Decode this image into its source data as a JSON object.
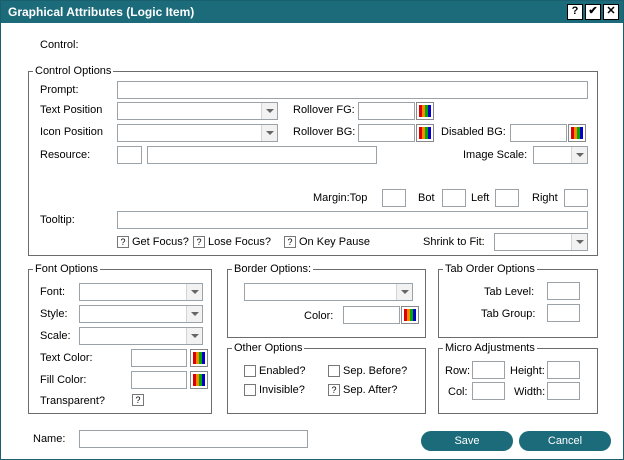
{
  "window": {
    "title": "Graphical Attributes (Logic Item)",
    "help_label": "?",
    "ok_label": "✔",
    "close_label": "✕"
  },
  "control": {
    "label": "Control:"
  },
  "control_options": {
    "legend": "Control Options",
    "prompt_label": "Prompt:",
    "text_position_label": "Text Position",
    "icon_position_label": "Icon Position",
    "resource_label": "Resource:",
    "rollover_fg_label": "Rollover FG:",
    "rollover_bg_label": "Rollover BG:",
    "disabled_bg_label": "Disabled BG:",
    "image_scale_label": "Image Scale:",
    "margin_top_label": "Margin:Top",
    "bot_label": "Bot",
    "left_label": "Left",
    "right_label": "Right",
    "tooltip_label": "Tooltip:",
    "get_focus_label": "Get Focus?",
    "lose_focus_label": "Lose Focus?",
    "on_key_pause_label": "On Key Pause",
    "shrink_to_fit_label": "Shrink to Fit:",
    "tri_state_mark": "?"
  },
  "font_options": {
    "legend": "Font Options",
    "font_label": "Font:",
    "style_label": "Style:",
    "scale_label": "Scale:",
    "text_color_label": "Text Color:",
    "fill_color_label": "Fill Color:",
    "transparent_label": "Transparent?",
    "transparent_mark": "?"
  },
  "border_options": {
    "legend": "Border Options:",
    "color_label": "Color:"
  },
  "tab_order_options": {
    "legend": "Tab Order Options",
    "tab_level_label": "Tab Level:",
    "tab_group_label": "Tab Group:"
  },
  "other_options": {
    "legend": "Other Options",
    "enabled_label": "Enabled?",
    "sep_before_label": "Sep. Before?",
    "invisible_label": "Invisible?",
    "sep_after_label": "Sep. After?",
    "sep_after_mark": "?"
  },
  "micro_adjustments": {
    "legend": "Micro Adjustments",
    "row_label": "Row:",
    "height_label": "Height:",
    "col_label": "Col:",
    "width_label": "Width:"
  },
  "footer": {
    "name_label": "Name:",
    "save_label": "Save",
    "cancel_label": "Cancel"
  },
  "colors": {
    "titlebar": "#1b6b7a",
    "button": "#1b6b7a",
    "border": "#6b6b6b"
  }
}
